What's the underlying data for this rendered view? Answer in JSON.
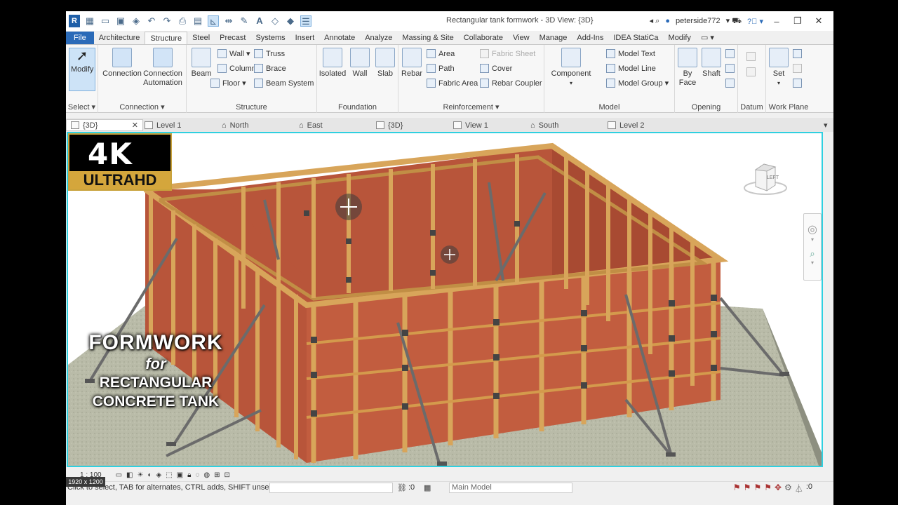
{
  "window": {
    "title": "Rectangular tank formwork - 3D View: {3D}",
    "user": "peterside772",
    "app_letter": "R"
  },
  "ribbon_tabs": [
    "File",
    "Architecture",
    "Structure",
    "Steel",
    "Precast",
    "Systems",
    "Insert",
    "Annotate",
    "Analyze",
    "Massing & Site",
    "Collaborate",
    "View",
    "Manage",
    "Add-Ins",
    "IDEA StatiCa",
    "Modify"
  ],
  "active_tab": "Structure",
  "ribbon": {
    "select": {
      "modify": "Modify",
      "title": "Select ▾"
    },
    "connection": {
      "connection": "Connection",
      "automation_1": "Connection",
      "automation_2": "Automation",
      "title": "Connection ▾"
    },
    "structure": {
      "beam": "Beam",
      "wall": "Wall ▾",
      "column": "Column",
      "floor": "Floor ▾",
      "truss": "Truss",
      "brace": "Brace",
      "beam_system": "Beam  System",
      "title": "Structure"
    },
    "foundation": {
      "isolated": "Isolated",
      "wall": "Wall",
      "slab": "Slab",
      "title": "Foundation"
    },
    "reinforcement": {
      "rebar": "Rebar",
      "area": "Area",
      "path": "Path",
      "fabric_area": "Fabric  Area",
      "fabric_sheet": "Fabric  Sheet",
      "cover": "Cover",
      "rebar_coupler": "Rebar  Coupler",
      "title": "Reinforcement ▾"
    },
    "model": {
      "component": "Component",
      "model_text": "Model  Text",
      "model_line": "Model  Line",
      "model_group": "Model  Group ▾",
      "title": "Model"
    },
    "opening": {
      "by_face_1": "By",
      "by_face_2": "Face",
      "shaft": "Shaft",
      "title": "Opening"
    },
    "datum": {
      "title": "Datum"
    },
    "work_plane": {
      "set": "Set",
      "title": "Work Plane"
    }
  },
  "view_tabs": [
    {
      "label": "{3D}",
      "active": true
    },
    {
      "label": "Level 1"
    },
    {
      "label": "North"
    },
    {
      "label": "East"
    },
    {
      "label": "{3D}"
    },
    {
      "label": "View 1"
    },
    {
      "label": "South"
    },
    {
      "label": "Level 2"
    }
  ],
  "overlay": {
    "badge_4k": "4K",
    "badge_ultra": "ULTRAHD",
    "banner_line1": "FORMWORK",
    "banner_line2": "for",
    "banner_line3": "RECTANGULAR",
    "banner_line4": "CONCRETE TANK"
  },
  "viewcube_label": "LEFT",
  "view_controls": {
    "scale": "1 : 100"
  },
  "status": {
    "hint": "Click to select, TAB for alternates, CTRL adds, SHIFT unselect",
    "resolution": "1920 x 1200",
    "workset_count": ":0",
    "model": "Main Model",
    "filter_count": ":0"
  },
  "colors": {
    "accent": "#2a6ab8",
    "viewport_border": "#2fd0e0",
    "formwork_panel": "#b8553a",
    "timber": "#d8a55a",
    "badge_gold": "#d4a63c"
  }
}
